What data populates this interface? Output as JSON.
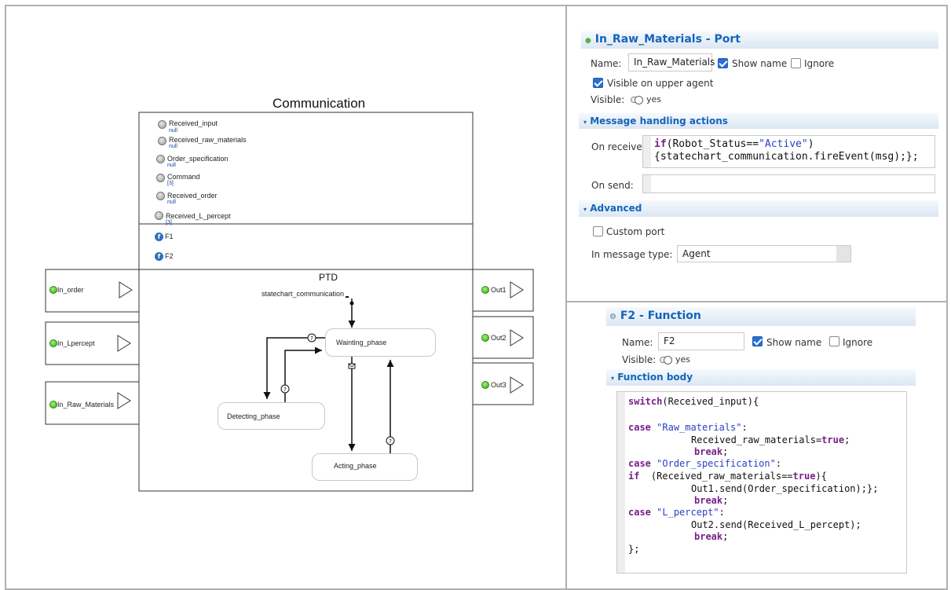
{
  "diagram": {
    "title": "Communication",
    "variables": [
      {
        "name": "Received_input",
        "value": "null"
      },
      {
        "name": "Received_raw_materials",
        "value": "null"
      },
      {
        "name": "Order_specification",
        "value": "null"
      },
      {
        "name": "Command",
        "value": "[3]"
      },
      {
        "name": "Received_order",
        "value": "null"
      },
      {
        "name": "Received_L_percept",
        "value": "[3]"
      }
    ],
    "functions": [
      "F1",
      "F2"
    ],
    "ptd_label": "PTD",
    "statechart_label": "statechart_communication",
    "states": {
      "waiting": "Wainting_phase",
      "detecting": "Detecting_phase",
      "acting": "Acting_phase"
    },
    "in_ports": [
      "In_order",
      "In_Lpercept",
      "In_Raw_Materials"
    ],
    "out_ports": [
      "Out1",
      "Out2",
      "Out3"
    ]
  },
  "port_panel": {
    "title": "In_Raw_Materials - Port",
    "name_label": "Name:",
    "name_value": "In_Raw_Materials",
    "show_name": "Show name",
    "ignore": "Ignore",
    "visible_upper": "Visible on upper agent",
    "visible_label": "Visible:",
    "visible_value": "yes",
    "msg_section": "Message handling actions",
    "on_receive_label": "On receive:",
    "on_receive_code_kw": "if",
    "on_receive_code_1a": "(Robot_Status==",
    "on_receive_code_str": "\"Active\"",
    "on_receive_code_1b": ")",
    "on_receive_code_2": "{statechart_communication.fireEvent(msg);};",
    "on_send_label": "On send:",
    "advanced_section": "Advanced",
    "custom_port": "Custom port",
    "msg_type_label": "In message type:",
    "msg_type_value": "Agent"
  },
  "function_panel": {
    "title": "F2 - Function",
    "name_label": "Name:",
    "name_value": "F2",
    "show_name": "Show name",
    "ignore": "Ignore",
    "visible_label": "Visible:",
    "visible_value": "yes",
    "body_section": "Function body",
    "code": {
      "l1_kw": "switch",
      "l1_rest": "(Received_input){",
      "l3_kw": "case",
      "l3_str": "\"Raw_materials\"",
      "l3_rest": ":",
      "l4_a": "Received_raw_materials=",
      "l4_kw": "true",
      "l4_b": ";",
      "l5_kw": "break",
      "l5_rest": ";",
      "l6_kw": "case",
      "l6_str": "\"Order_specification\"",
      "l6_rest": ":",
      "l7_kw": "if",
      "l7_a": "  (Received_raw_materials==",
      "l7_kw2": "true",
      "l7_b": "){",
      "l8": "Out1.send(Order_specification);};",
      "l9_kw": "break",
      "l9_rest": ";",
      "l10_kw": "case",
      "l10_str": "\"L_percept\"",
      "l10_rest": ":",
      "l11": "Out2.send(Received_L_percept);",
      "l12_kw": "break",
      "l12_rest": ";",
      "l13": "};"
    }
  }
}
